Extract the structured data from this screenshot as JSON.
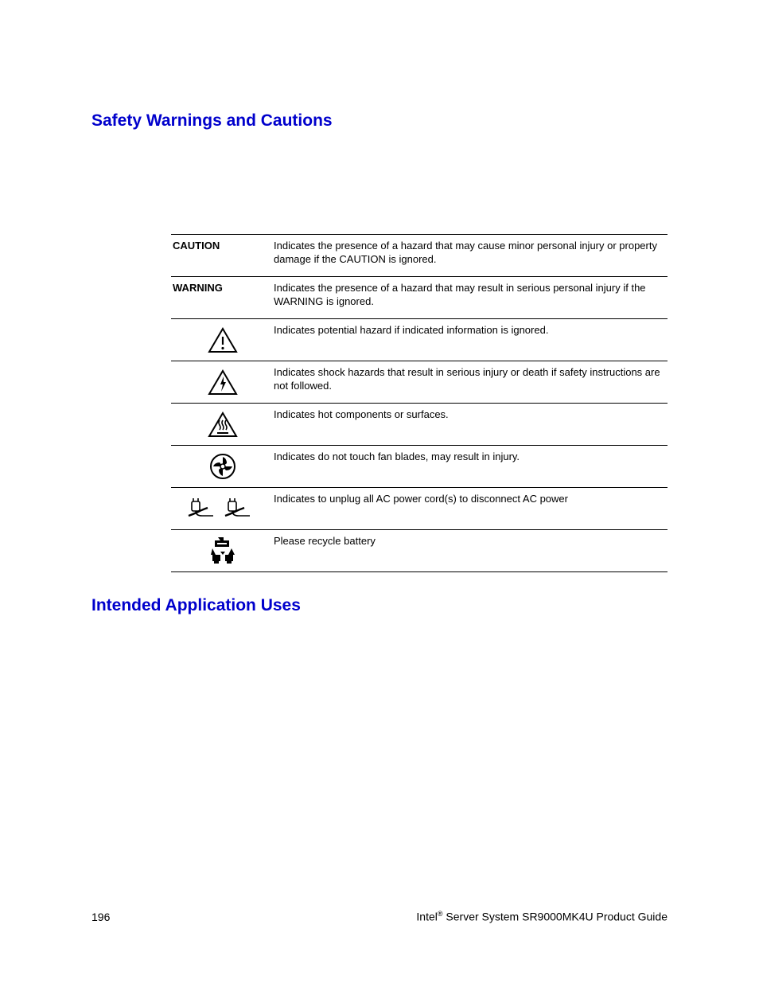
{
  "headings": {
    "safety": "Safety Warnings and Cautions",
    "intended": "Intended Application Uses"
  },
  "rows": [
    {
      "label": "CAUTION",
      "desc": "Indicates the presence of a hazard that may cause minor personal injury or property damage if the CAUTION is ignored."
    },
    {
      "label": "WARNING",
      "desc": "Indicates the presence of a hazard that may result in serious personal injury if the WARNING is ignored."
    },
    {
      "icon": "exclaim-triangle-icon",
      "desc": "Indicates potential hazard if indicated information is ignored."
    },
    {
      "icon": "shock-triangle-icon",
      "desc": "Indicates shock hazards that result in serious injury or death if safety instructions are not followed."
    },
    {
      "icon": "hot-triangle-icon",
      "desc": "Indicates hot components or surfaces."
    },
    {
      "icon": "fan-icon",
      "desc": "Indicates do not touch fan blades, may result in injury."
    },
    {
      "icon": "unplug-icon",
      "desc": "Indicates to unplug all AC power cord(s) to disconnect AC power"
    },
    {
      "icon": "recycle-battery-icon",
      "desc": "Please recycle battery"
    }
  ],
  "footer": {
    "page_number": "196",
    "brand": "Intel",
    "reg": "®",
    "product_line": " Server System SR9000MK4U Product Guide"
  }
}
